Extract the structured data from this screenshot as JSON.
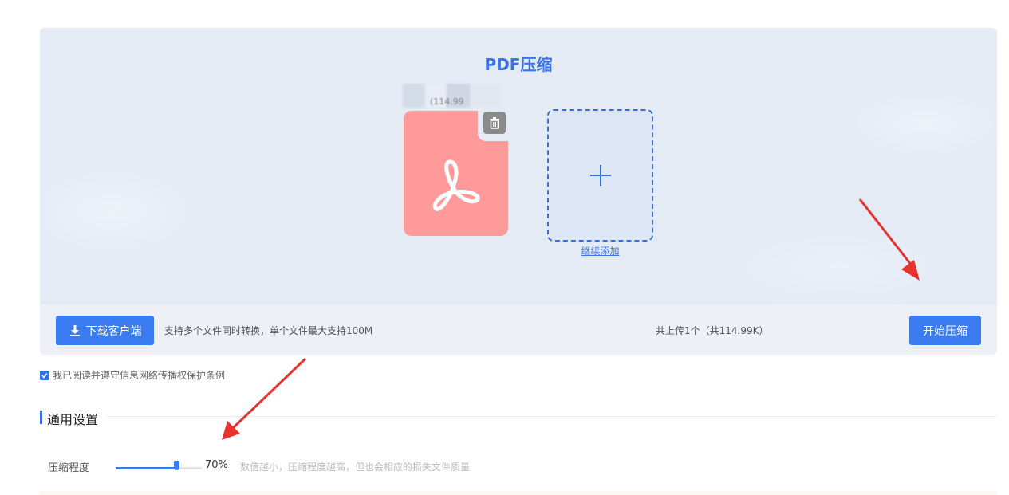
{
  "upload": {
    "title": "PDF压缩",
    "file": {
      "name": "",
      "size": "(114.99"
    },
    "add_more_label": "继续添加"
  },
  "toolbar": {
    "download_label": "下载客户端",
    "hint": "支持多个文件同时转换，单个文件最大支持100M",
    "upload_count": "共上传1个（共114.99K）",
    "start_label": "开始压缩"
  },
  "agreement": {
    "label": "我已阅读并遵守信息网络传播权保护条例",
    "checked": true
  },
  "settings": {
    "section_title": "通用设置",
    "compression": {
      "label": "压缩程度",
      "value": 70,
      "value_label": "70%",
      "description": "数值越小，压缩程度越高，但也会相应的损失文件质量"
    }
  },
  "colors": {
    "accent": "#3a7cf0",
    "title": "#3a73e8",
    "pdf_icon": "#ff9a9a",
    "annotation_arrow": "#e8322e"
  },
  "icons": {
    "pdf": "pdf-acrobat-icon",
    "delete": "trash-icon",
    "add": "plus-icon",
    "download": "download-icon",
    "check": "checkmark-icon"
  }
}
